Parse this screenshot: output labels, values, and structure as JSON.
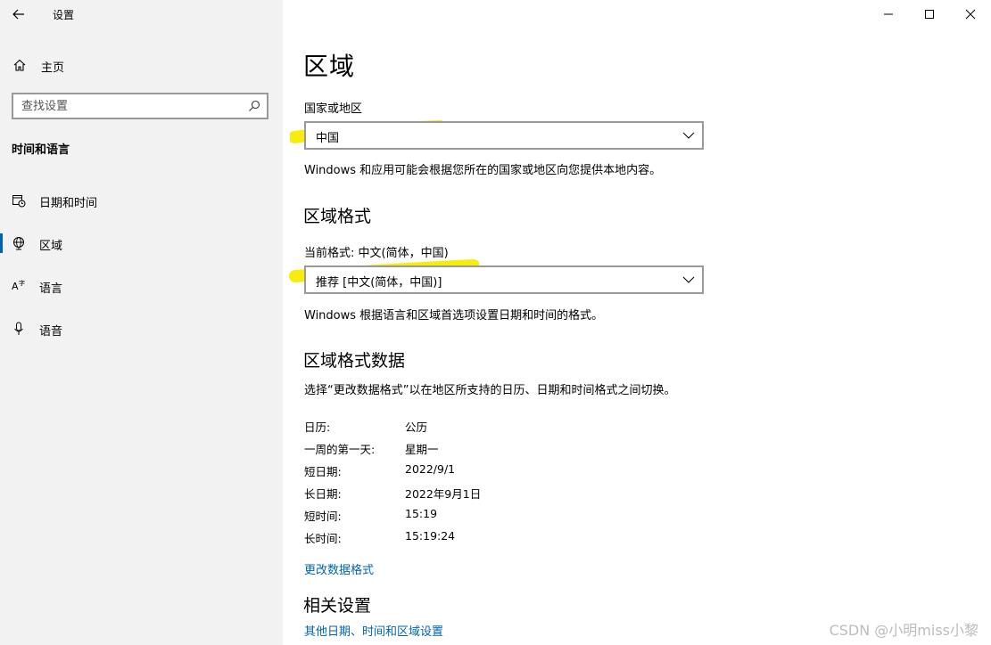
{
  "window": {
    "title": "设置",
    "controls": {
      "minimize": "minimize",
      "maximize": "maximize",
      "close": "close"
    }
  },
  "sidebar": {
    "home_label": "主页",
    "search": {
      "placeholder": "查找设置",
      "value": ""
    },
    "section_heading": "时间和语言",
    "items": [
      {
        "label": "日期和时间",
        "icon": "calendar-clock-icon",
        "selected": false
      },
      {
        "label": "区域",
        "icon": "globe-icon",
        "selected": true
      },
      {
        "label": "语言",
        "icon": "language-icon",
        "selected": false
      },
      {
        "label": "语音",
        "icon": "microphone-icon",
        "selected": false
      }
    ]
  },
  "main": {
    "title": "区域",
    "country": {
      "label": "国家或地区",
      "value": "中国",
      "description": "Windows 和应用可能会根据您所在的国家或地区向您提供本地内容。"
    },
    "format": {
      "heading": "区域格式",
      "label": "当前格式: 中文(简体，中国)",
      "value": "推荐 [中文(简体，中国)]",
      "description": "Windows 根据语言和区域首选项设置日期和时间的格式。"
    },
    "format_data": {
      "heading": "区域格式数据",
      "description": "选择“更改数据格式”以在地区所支持的日历、日期和时间格式之间切换。",
      "rows": [
        {
          "key": "日历:",
          "value": "公历"
        },
        {
          "key": "一周的第一天:",
          "value": "星期一"
        },
        {
          "key": "短日期:",
          "value": "2022/9/1"
        },
        {
          "key": "长日期:",
          "value": "2022年9月1日"
        },
        {
          "key": "短时间:",
          "value": "15:19"
        },
        {
          "key": "长时间:",
          "value": "15:19:24"
        }
      ],
      "change_link": "更改数据格式"
    },
    "related": {
      "heading": "相关设置",
      "link": "其他日期、时间和区域设置"
    }
  },
  "watermark": "CSDN @小明miss小黎",
  "colors": {
    "accent": "#0063b1",
    "sidebar_bg": "#f2f2f2",
    "highlighter": "#f5ec00",
    "border": "#999999"
  }
}
